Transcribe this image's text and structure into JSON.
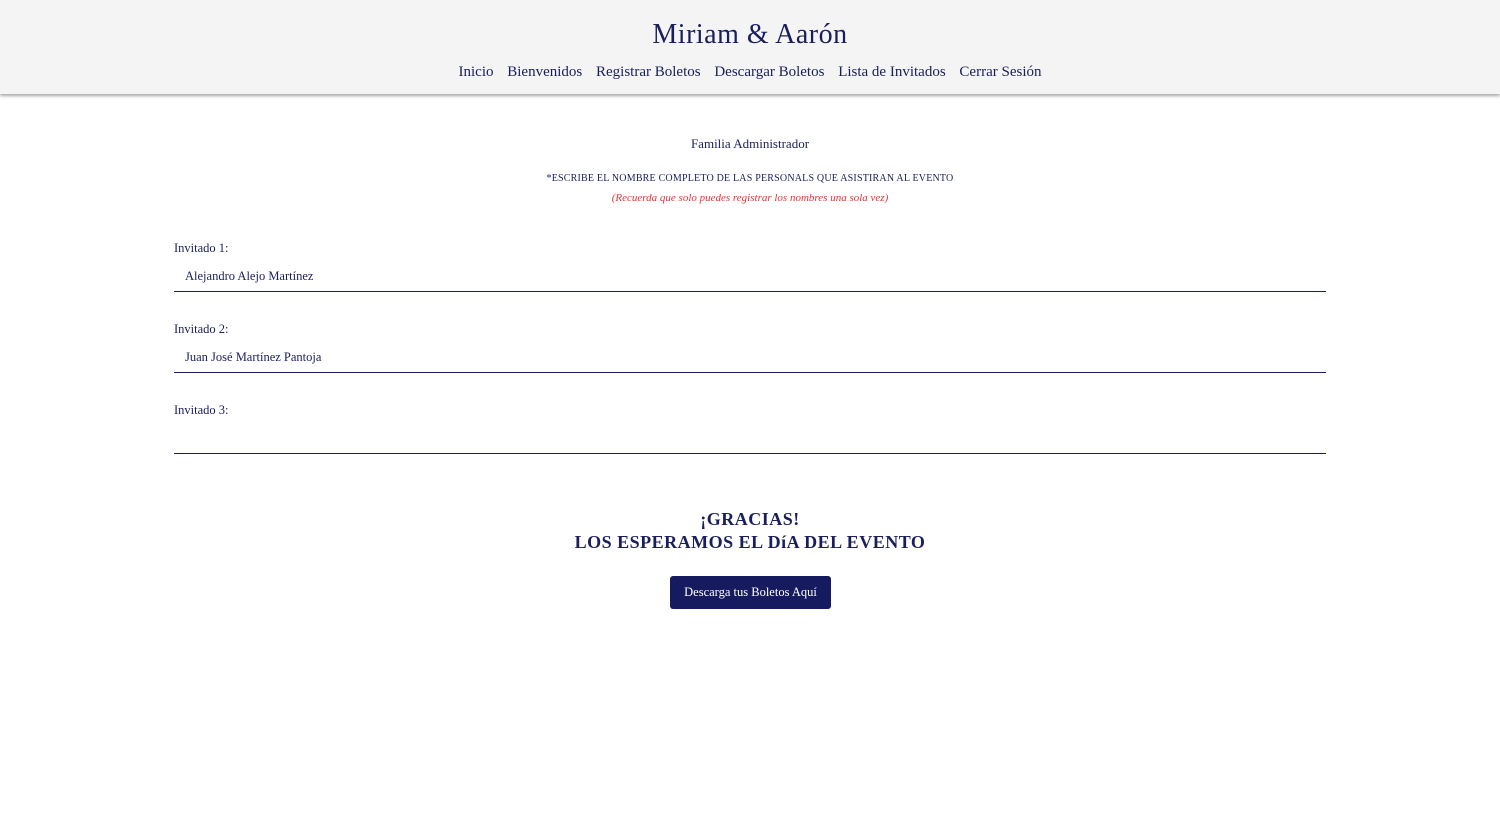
{
  "header": {
    "brand": "Miriam & Aarón",
    "nav": [
      {
        "label": "Inicio"
      },
      {
        "label": "Bienvenidos"
      },
      {
        "label": "Registrar Boletos"
      },
      {
        "label": "Descargar Boletos"
      },
      {
        "label": "Lista de Invitados"
      },
      {
        "label": "Cerrar Sesión"
      }
    ]
  },
  "main": {
    "family_name": "Familia Administrador",
    "instruction": "*ESCRIBE EL NOMBRE COMPLETO DE LAS PERSONALS QUE ASISTIRAN AL EVENTO",
    "reminder": "(Recuerda que solo puedes registrar los nombres una sola vez)",
    "guests": [
      {
        "label": "Invitado 1:",
        "value": "Alejandro Alejo Martínez"
      },
      {
        "label": "Invitado 2:",
        "value": "Juan José Martínez Pantoja"
      },
      {
        "label": "Invitado 3:",
        "value": ""
      }
    ],
    "thanks_line1": "¡GRACIAS!",
    "thanks_line2": "LOS ESPERAMOS EL DíA DEL EVENTO",
    "download_button": "Descarga tus Boletos Aquí"
  },
  "colors": {
    "primary": "#1a1f5c",
    "button": "#161a5e",
    "reminder": "#d83a3a",
    "header_bg": "#f4f4f4"
  }
}
